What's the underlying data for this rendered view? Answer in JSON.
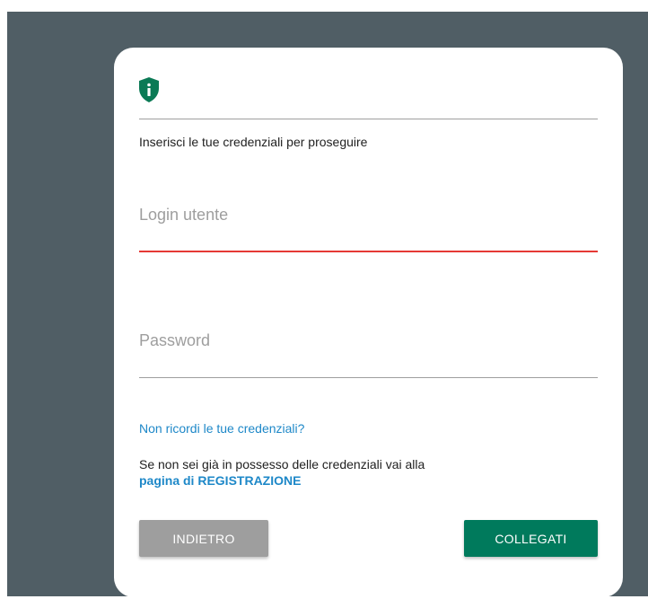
{
  "colors": {
    "background": "#505e65",
    "card": "#ffffff",
    "shield": "#0b7a55",
    "link": "#1e88c8",
    "error_underline": "#e53935",
    "primary_button": "#007a5c",
    "secondary_button": "#9e9e9e"
  },
  "header": {
    "icon": "shield-info-icon"
  },
  "form": {
    "intro": "Inserisci le tue credenziali per proseguire",
    "login": {
      "placeholder": "Login utente",
      "value": ""
    },
    "password": {
      "placeholder": "Password",
      "value": ""
    },
    "forgot_link": "Non ricordi le tue credenziali?",
    "registration_text": "Se non sei già in possesso delle credenziali vai alla",
    "registration_link": "pagina di REGISTRAZIONE"
  },
  "actions": {
    "back_label": "INDIETRO",
    "login_label": "COLLEGATI"
  }
}
